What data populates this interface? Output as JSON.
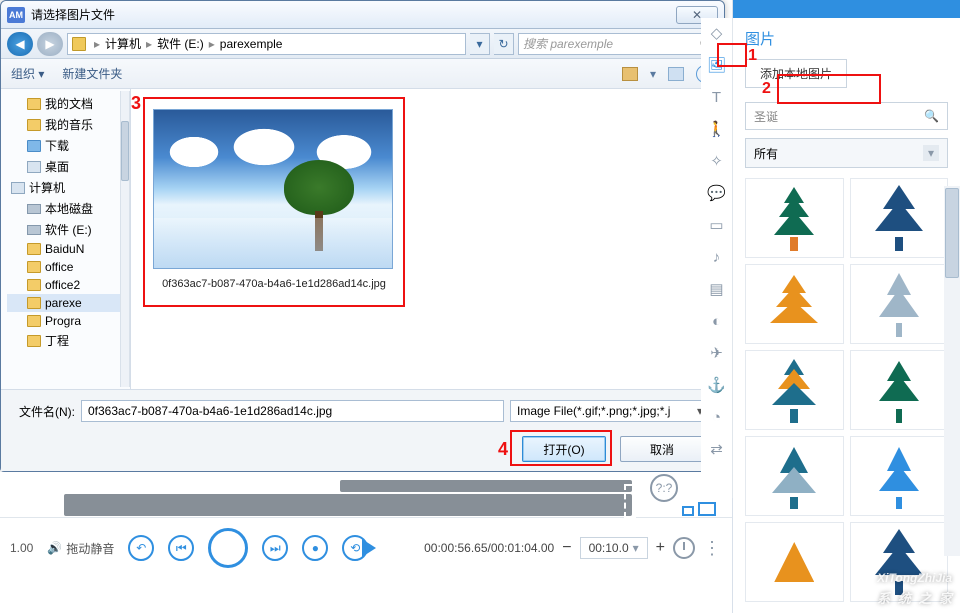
{
  "dialog": {
    "am": "AM",
    "title": "请选择图片文件",
    "close_glyph": "✕",
    "nav": {
      "back_glyph": "◀",
      "fwd_glyph": "▶",
      "crumbs": [
        "计算机",
        "软件 (E:)",
        "parexemple"
      ],
      "sep": "▸",
      "refresh_glyph": "↻",
      "dd_glyph": "▾"
    },
    "search_placeholder": "搜索 parexemple",
    "search_glyph": "🔍",
    "toolbar": {
      "organize": "组织 ▾",
      "newfolder": "新建文件夹",
      "help_glyph": "?"
    },
    "tree": [
      {
        "icon": "fld",
        "label": "我的文档"
      },
      {
        "icon": "fld",
        "label": "我的音乐"
      },
      {
        "icon": "fld blue",
        "label": "下载"
      },
      {
        "icon": "pc",
        "label": "桌面"
      },
      {
        "icon": "pc",
        "label": "计算机",
        "indent": 0
      },
      {
        "icon": "hd",
        "label": "本地磁盘"
      },
      {
        "icon": "hd",
        "label": "软件 (E:)"
      },
      {
        "icon": "fld",
        "label": "BaiduN"
      },
      {
        "icon": "fld",
        "label": "office"
      },
      {
        "icon": "fld",
        "label": "office2"
      },
      {
        "icon": "fld",
        "label": "parexe",
        "sel": true
      },
      {
        "icon": "fld",
        "label": "Progra"
      },
      {
        "icon": "fld",
        "label": "丁程"
      }
    ],
    "thumb_caption": "0f363ac7-b087-470a-b4a6-1e1d286ad14c.jpg",
    "filename_label": "文件名(N):",
    "filename_value": "0f363ac7-b087-470a-b4a6-1e1d286ad14c.jpg",
    "filter_value": "Image File(*.gif;*.png;*.jpg;*.j",
    "open_label": "打开(O)",
    "cancel_label": "取消",
    "dd": "▾"
  },
  "markers": {
    "m1": "1",
    "m2": "2",
    "m3": "3",
    "m4": "4"
  },
  "right": {
    "title": "图片",
    "add_local": "添加本地图片",
    "search_value": "圣诞",
    "search_glyph": "🔍",
    "filter_value": "所有",
    "dd": "▾",
    "tools": [
      {
        "name": "shape-icon",
        "g": "◇"
      },
      {
        "name": "image-icon",
        "g": "🖼",
        "sel": true
      },
      {
        "name": "text-icon",
        "g": "T"
      },
      {
        "name": "person-icon",
        "g": "🚶"
      },
      {
        "name": "wand-icon",
        "g": "✧"
      },
      {
        "name": "chat-icon",
        "g": "💬"
      },
      {
        "name": "folder-icon",
        "g": "▭"
      },
      {
        "name": "music-icon",
        "g": "♪"
      },
      {
        "name": "film-icon",
        "g": "▤"
      },
      {
        "name": "flash-icon",
        "g": "◐"
      },
      {
        "name": "plane-icon",
        "g": "✈"
      },
      {
        "name": "anchor-icon",
        "g": "⚓"
      },
      {
        "name": "pie-icon",
        "g": "◔"
      },
      {
        "name": "transfer-icon",
        "g": "⇄"
      },
      {
        "name": "asterisk-icon",
        "g": "✱"
      }
    ]
  },
  "bottom": {
    "zoom": "1.00",
    "mute": "拖动静音",
    "spk_glyph": "🔊",
    "undo_glyph": "↶",
    "prev_glyph": "⏮",
    "next_glyph": "⏭",
    "rec_glyph": "●",
    "loop_glyph": "⟲",
    "qmark": "?:?",
    "time": "00:00:56.65/00:01:04.00",
    "step": "00:10.0",
    "step_dd": "▾",
    "plus": "+",
    "minus": "−",
    "dots": "⋮"
  },
  "watermark": {
    "en": "XiTongZhiJia",
    "cn": "系 统 之 家"
  }
}
